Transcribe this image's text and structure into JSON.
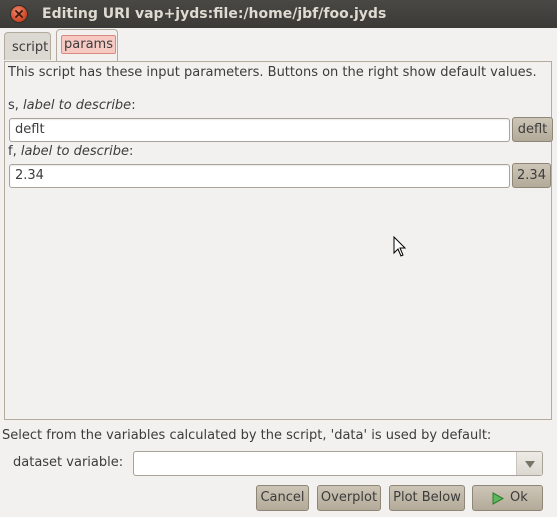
{
  "window": {
    "title": "Editing URI vap+jyds:file:/home/jbf/foo.jyds"
  },
  "tabs": [
    {
      "label": "script",
      "selected": false
    },
    {
      "label": "params",
      "selected": true
    }
  ],
  "params_panel": {
    "description": "This script has these input parameters.  Buttons on the right show default values.",
    "params": [
      {
        "name": "s, ",
        "label": "label to describe",
        "suffix": ":",
        "value": "deflt",
        "default_label": "deflt"
      },
      {
        "name": "f, ",
        "label": "label to describe",
        "suffix": ":",
        "value": "2.34",
        "default_label": "2.34"
      }
    ]
  },
  "variables": {
    "hint": "Select from the variables calculated by the script, 'data' is used by default:",
    "dataset_label": "dataset variable:",
    "dataset_value": ""
  },
  "buttons": {
    "cancel": "Cancel",
    "overplot": "Overplot",
    "plot_below": "Plot Below",
    "ok": "Ok"
  },
  "colors": {
    "background": "#f2f1f0",
    "titlebar": "#3c3b37",
    "close_button": "#d9542f",
    "active_tab_highlight": "#f6c9c3",
    "ok_icon": "#3aa03a"
  },
  "icons": [
    "close-icon",
    "play-icon",
    "combo-arrow-icon",
    "mouse-cursor-icon"
  ]
}
